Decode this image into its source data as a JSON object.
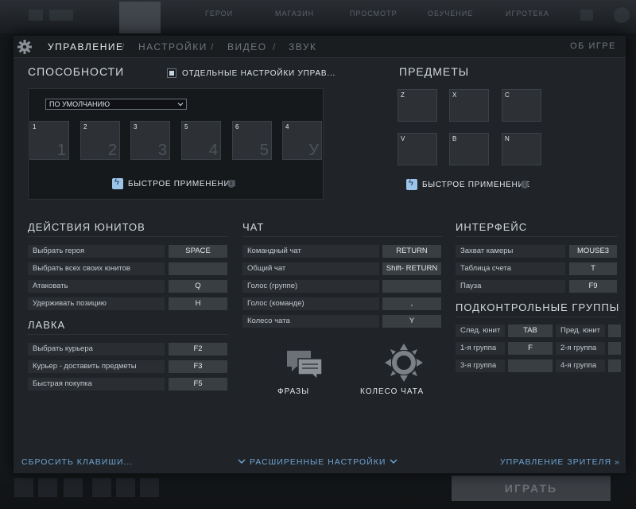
{
  "background": {
    "top_tabs": [
      "ГЕРОИ",
      "МАГАЗИН",
      "ПРОСМОТР",
      "ОБУЧЕНИЕ",
      "ИГРОТЕКА"
    ],
    "play_button": "ИГРАТЬ"
  },
  "nav": {
    "tabs": [
      "УПРАВЛЕНИЕ",
      "НАСТРОЙКИ",
      "ВИДЕО",
      "ЗВУК"
    ],
    "separator": "/",
    "about": "ОБ ИГРЕ"
  },
  "abilities": {
    "title": "СПОСОБНОСТИ",
    "separate_checkbox_label": "ОТДЕЛЬНЫЕ НАСТРОЙКИ УПРАВ...",
    "dropdown_value": "ПО УМОЛЧАНИЮ",
    "slots": [
      {
        "key": "1",
        "big": "1"
      },
      {
        "key": "2",
        "big": "2"
      },
      {
        "key": "3",
        "big": "3"
      },
      {
        "key": "5",
        "big": "4"
      },
      {
        "key": "6",
        "big": "5"
      },
      {
        "key": "4",
        "big": "У"
      }
    ],
    "quick_cast": "БЫСТРОЕ ПРИМЕНЕНИЕ"
  },
  "items": {
    "title": "ПРЕДМЕТЫ",
    "slots": [
      "Z",
      "X",
      "C",
      "V",
      "B",
      "N"
    ],
    "quick_cast": "БЫСТРОЕ ПРИМЕНЕНИЕ"
  },
  "unit_actions": {
    "title": "ДЕЙСТВИЯ ЮНИТОВ",
    "rows": [
      {
        "label": "Выбрать героя",
        "key": "SPACE"
      },
      {
        "label": "Выбрать всех своих юнитов",
        "key": ""
      },
      {
        "label": "Атаковать",
        "key": "Q"
      },
      {
        "label": "Удерживать позицию",
        "key": "H"
      }
    ]
  },
  "shop": {
    "title": "ЛАВКА",
    "rows": [
      {
        "label": "Выбрать курьера",
        "key": "F2"
      },
      {
        "label": "Курьер - доставить предметы",
        "key": "F3"
      },
      {
        "label": "Быстрая покупка",
        "key": "F5"
      }
    ]
  },
  "chat": {
    "title": "ЧАТ",
    "rows": [
      {
        "label": "Командный чат",
        "key": "RETURN"
      },
      {
        "label": "Общий чат",
        "key": "Shift- RETURN"
      },
      {
        "label": "Голос (группе)",
        "key": ""
      },
      {
        "label": "Голос (команде)",
        "key": ","
      },
      {
        "label": "Колесо чата",
        "key": "Y"
      }
    ],
    "phrases_label": "ФРАЗЫ",
    "wheel_label": "КОЛЕСО ЧАТА"
  },
  "interface": {
    "title": "ИНТЕРФЕЙС",
    "rows": [
      {
        "label": "Захват камеры",
        "key": "MOUSE3"
      },
      {
        "label": "Таблица счета",
        "key": "T"
      },
      {
        "label": "Пауза",
        "key": "F9"
      }
    ]
  },
  "control_groups": {
    "title": "ПОДКОНТРОЛЬНЫЕ ГРУППЫ",
    "rows": [
      {
        "left_label": "След. юнит",
        "left_key": "TAB",
        "right_label": "Пред. юнит",
        "right_key": ""
      },
      {
        "left_label": "1-я группа",
        "left_key": "F",
        "right_label": "2-я группа",
        "right_key": ""
      },
      {
        "left_label": "3-я группа",
        "left_key": "",
        "right_label": "4-я группа",
        "right_key": ""
      }
    ]
  },
  "footer": {
    "reset": "СБРОСИТЬ КЛАВИШИ...",
    "advanced": "РАСШИРЕННЫЕ НАСТРОЙКИ",
    "spectator": "УПРАВЛЕНИЕ ЗРИТЕЛЯ »"
  }
}
